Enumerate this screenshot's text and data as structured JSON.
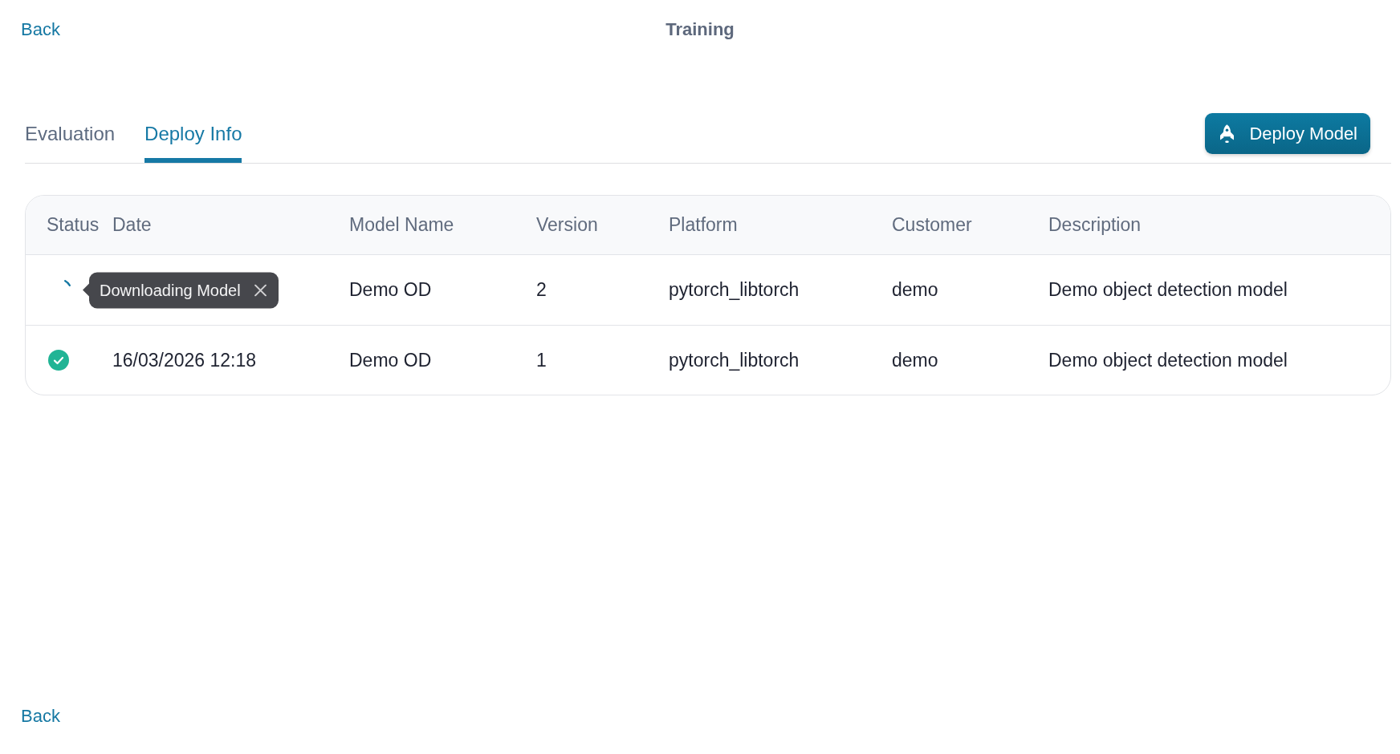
{
  "header": {
    "back_link": "Back",
    "title": "Training"
  },
  "tabs": [
    {
      "label": "Evaluation",
      "selected": false
    },
    {
      "label": "Deploy Info",
      "selected": true
    }
  ],
  "deploy_button": {
    "label": "Deploy Model"
  },
  "table": {
    "columns": [
      "Status",
      "Date",
      "Model Name",
      "Version",
      "Platform",
      "Customer",
      "Description"
    ],
    "rows": [
      {
        "status": {
          "kind": "downloading"
        },
        "tooltip": {
          "text": "Downloading Model"
        },
        "model_name": "Demo OD",
        "version": "2",
        "platform": "pytorch_libtorch",
        "customer": "demo",
        "description": "Demo object detection model"
      },
      {
        "status": {
          "kind": "completed"
        },
        "date": "16/03/2026 12:18",
        "model_name": "Demo OD",
        "version": "1",
        "platform": "pytorch_libtorch",
        "customer": "demo",
        "description": "Demo object detection model"
      }
    ]
  },
  "footer": {
    "back_link": "Back"
  }
}
